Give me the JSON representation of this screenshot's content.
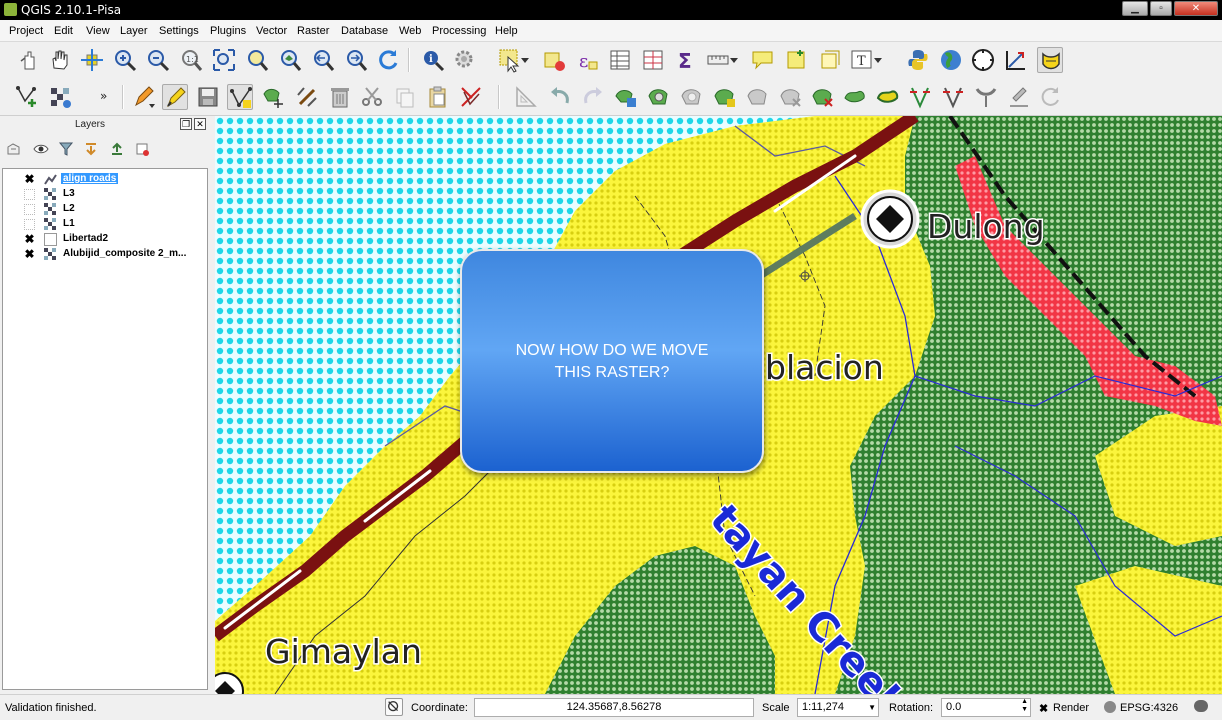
{
  "window": {
    "title": "QGIS 2.10.1-Pisa"
  },
  "menubar": {
    "items": [
      "Project",
      "Edit",
      "View",
      "Layer",
      "Settings",
      "Plugins",
      "Vector",
      "Raster",
      "Database",
      "Web",
      "Processing",
      "Help"
    ]
  },
  "toolbar1": {
    "icons": [
      "pan-touch-icon",
      "pan-hand-icon",
      "pan-to-selection-icon",
      "zoom-in-icon",
      "zoom-out-icon",
      "zoom-native-icon",
      "zoom-full-icon",
      "zoom-to-selection-icon",
      "zoom-to-layer-icon",
      "zoom-last-icon",
      "zoom-next-icon",
      "refresh-icon",
      "identify-icon",
      "action-icon",
      "select-feature-icon",
      "deselect-icon",
      "expression-select-icon",
      "attribute-table-icon",
      "field-calculator-icon",
      "statistics-icon",
      "measure-icon",
      "map-tips-icon",
      "new-bookmark-icon",
      "show-bookmarks-icon",
      "text-annotation-icon",
      "python-console-icon",
      "globe-icon",
      "compass-icon",
      "georeferencer-icon",
      "freehand-raster-georeferencer-icon"
    ]
  },
  "toolbar2": {
    "icons": [
      "digitize-point-icon",
      "digitize-grid-icon",
      "current-edits-icon",
      "toggle-editing-icon",
      "save-edits-icon",
      "add-feature-icon",
      "move-feature-icon",
      "node-tool-icon",
      "delete-selected-icon",
      "cut-features-icon",
      "copy-features-icon",
      "paste-features-icon",
      "advanced-digitize-icon",
      "rotate-feature-icon",
      "undo-icon",
      "redo-icon",
      "simplify-feature-icon",
      "add-ring-icon",
      "add-part-icon",
      "fill-ring-icon",
      "delete-ring-icon",
      "delete-part-icon",
      "reshape-features-icon",
      "offset-curve-icon",
      "split-features-icon",
      "split-parts-icon",
      "merge-features-icon",
      "merge-attributes-icon",
      "rotate-point-symbols-icon",
      "spin-icon"
    ]
  },
  "layers_panel": {
    "title": "Layers",
    "items": [
      {
        "name": "align roads",
        "checked": true,
        "selected": true,
        "icon": "vector-line-icon"
      },
      {
        "name": "L3",
        "checked": false,
        "selected": false,
        "icon": "raster-icon"
      },
      {
        "name": "L2",
        "checked": false,
        "selected": false,
        "icon": "raster-icon"
      },
      {
        "name": "L1",
        "checked": false,
        "selected": false,
        "icon": "raster-icon"
      },
      {
        "name": "Libertad2",
        "checked": true,
        "selected": false,
        "icon": "raster-white-icon"
      },
      {
        "name": "Alubijid_composite 2_m...",
        "checked": true,
        "selected": false,
        "icon": "raster-icon"
      }
    ]
  },
  "map": {
    "labels": [
      "Dulong",
      "blacion",
      "Gimaylan",
      "tayan Creek"
    ],
    "colors": {
      "water": "#1fd7e8",
      "lowland": "#f5f21d",
      "forest": "#3c8f37",
      "hazard": "#f32a3a",
      "road": "#7a1111",
      "stream": "#2a2ad6"
    }
  },
  "callout": {
    "text": "NOW HOW DO WE MOVE\nTHIS RASTER?"
  },
  "statusbar": {
    "message": "Validation finished.",
    "coordinate_label": "Coordinate:",
    "coordinate_value": "124.35687,8.56278",
    "scale_label": "Scale",
    "scale_value": "1:11,274",
    "rotation_label": "Rotation:",
    "rotation_value": "0.0",
    "render_label": "Render",
    "crs_label": "EPSG:4326"
  }
}
